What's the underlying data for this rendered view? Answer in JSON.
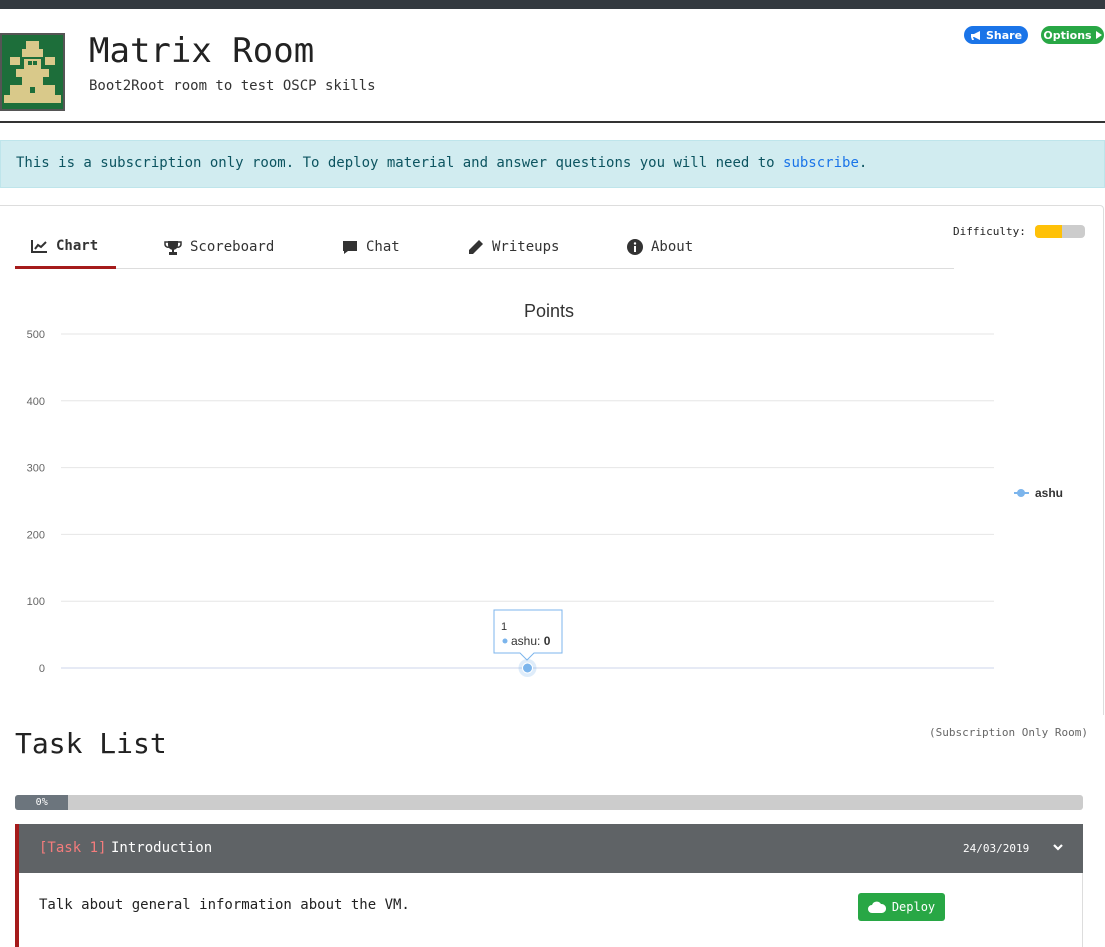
{
  "room": {
    "title": "Matrix Room",
    "subtitle": "Boot2Root room to test OSCP skills",
    "share_label": "Share",
    "options_label": "Options"
  },
  "alert": {
    "text": "This is a subscription only room. To deploy material and answer questions you will need to ",
    "link": "subscribe",
    "suffix": "."
  },
  "tabs": [
    {
      "label": "Chart",
      "icon": "chart-line-icon",
      "active": true
    },
    {
      "label": "Scoreboard",
      "icon": "trophy-icon",
      "active": false
    },
    {
      "label": "Chat",
      "icon": "chat-bubble-icon",
      "active": false
    },
    {
      "label": "Writeups",
      "icon": "pencil-icon",
      "active": false
    },
    {
      "label": "About",
      "icon": "info-icon",
      "active": false
    }
  ],
  "difficulty": {
    "label": "Difficulty:",
    "level": 0.55,
    "color": "#ffc107"
  },
  "chart_data": {
    "type": "line",
    "title": "Points",
    "ylim": [
      0,
      500
    ],
    "yticks": [
      0,
      100,
      200,
      300,
      400,
      500
    ],
    "grid": true,
    "legend_position": "right",
    "series": [
      {
        "name": "ashu",
        "color": "#7cb5ec",
        "points": [
          {
            "x": 1,
            "y": 0
          }
        ]
      }
    ],
    "tooltip": {
      "header": "1",
      "series": "ashu",
      "value": "0"
    }
  },
  "tasks_section": {
    "title": "Task List",
    "note": "(Subscription Only Room)",
    "progress_label": "0%",
    "progress": 0
  },
  "tasks": [
    {
      "number": "[Task 1]",
      "name": "Introduction",
      "date": "24/03/2019",
      "description": "Talk about general information about the VM.",
      "deploy_label": "Deploy"
    }
  ],
  "colors": {
    "accent": "#a51b1b",
    "share": "#1a74e8",
    "success": "#28a745",
    "alert_bg": "#d1ecf0"
  }
}
